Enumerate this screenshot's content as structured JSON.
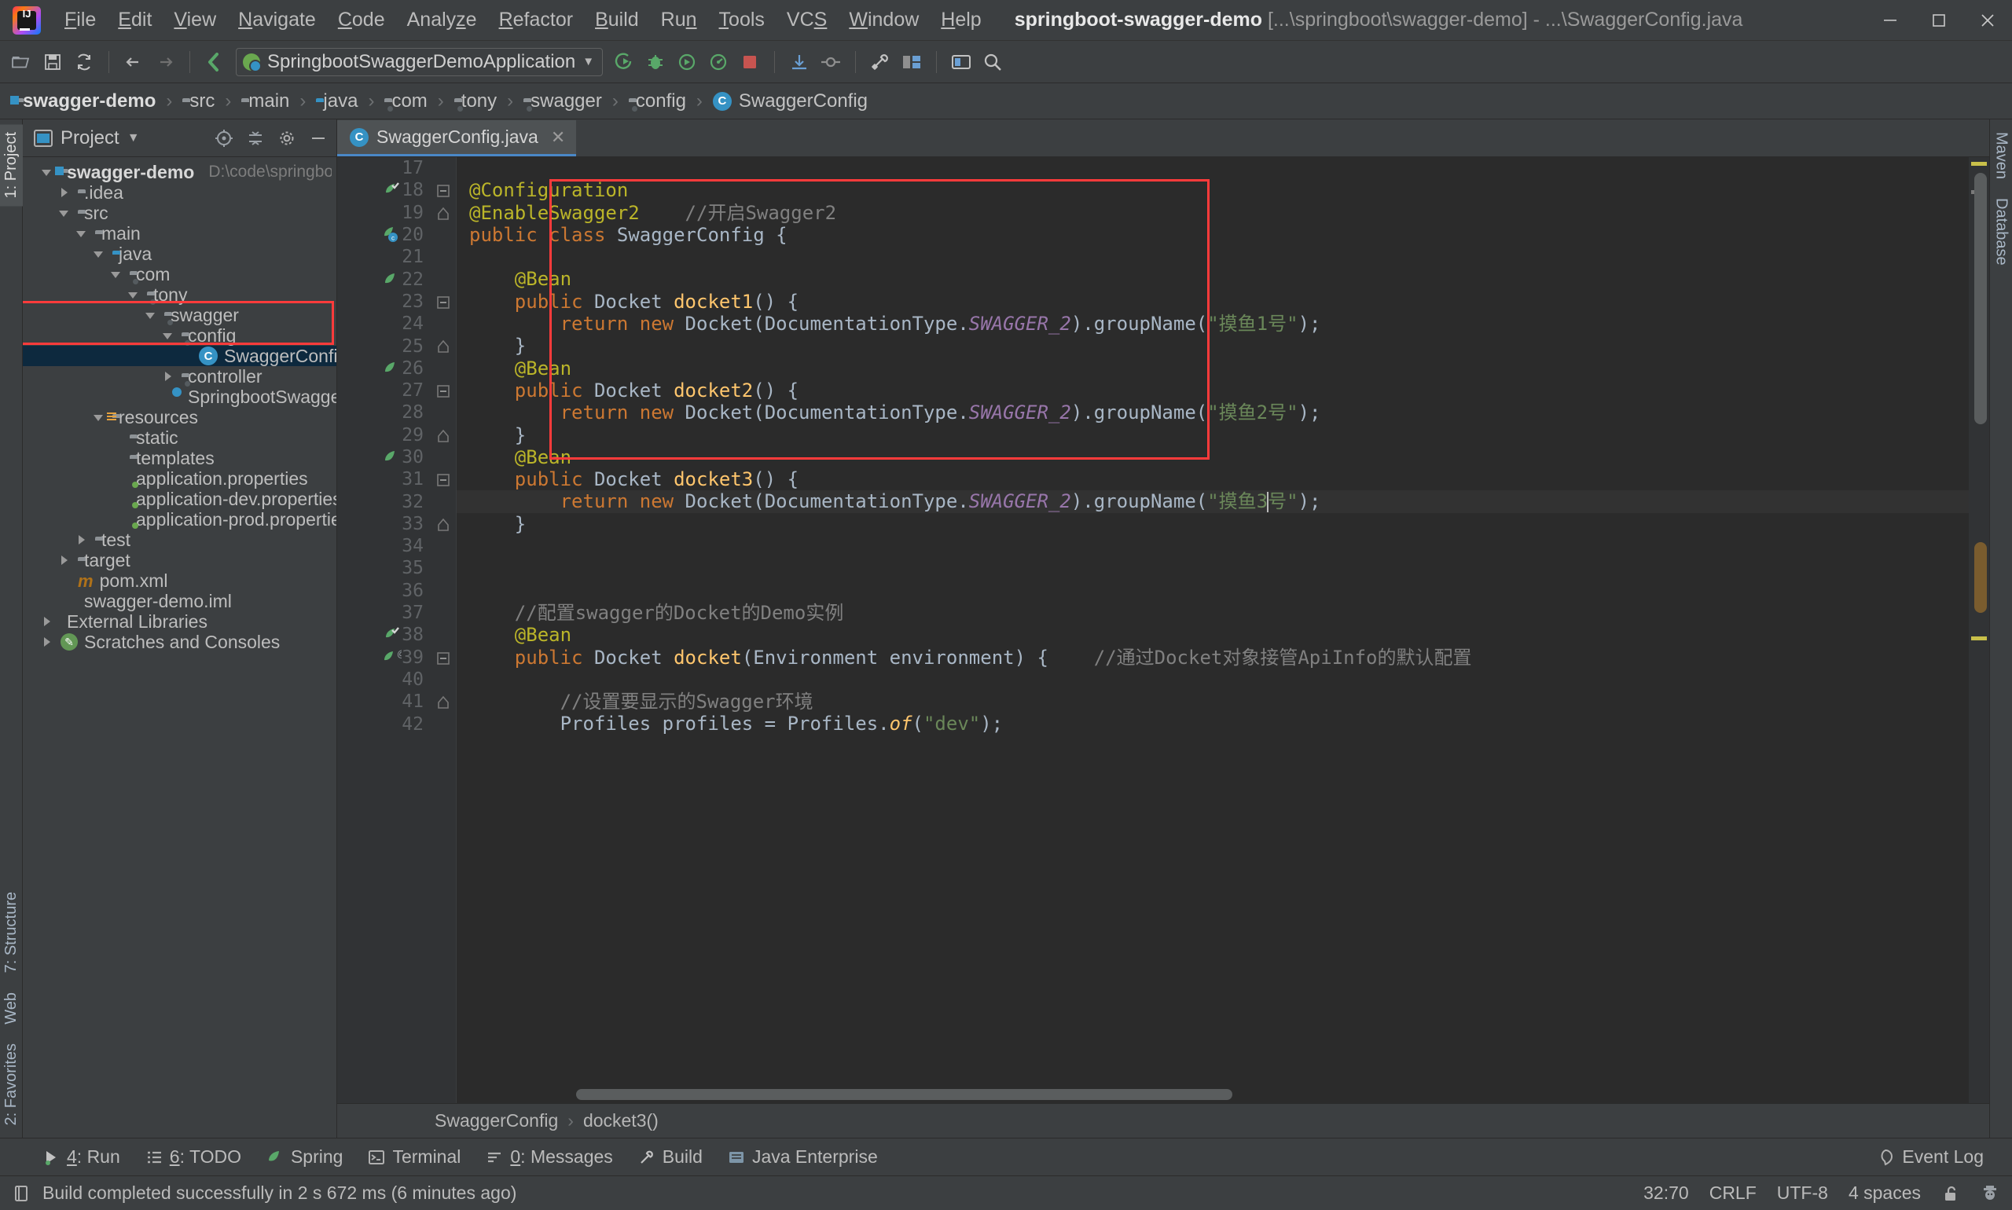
{
  "window": {
    "title_project": "springboot-swagger-demo",
    "title_path": "[...\\springboot\\swagger-demo] - ...\\SwaggerConfig.java",
    "minimize": "—",
    "maximize": "❐",
    "close": "✕"
  },
  "menu": [
    {
      "label": "File",
      "mnemonic": "F"
    },
    {
      "label": "Edit",
      "mnemonic": "E"
    },
    {
      "label": "View",
      "mnemonic": "V"
    },
    {
      "label": "Navigate",
      "mnemonic": "N"
    },
    {
      "label": "Code",
      "mnemonic": "C"
    },
    {
      "label": "Analyze",
      "mnemonic": "z"
    },
    {
      "label": "Refactor",
      "mnemonic": "R"
    },
    {
      "label": "Build",
      "mnemonic": "B"
    },
    {
      "label": "Run",
      "mnemonic": "n"
    },
    {
      "label": "Tools",
      "mnemonic": "T"
    },
    {
      "label": "VCS",
      "mnemonic": "S"
    },
    {
      "label": "Window",
      "mnemonic": "W"
    },
    {
      "label": "Help",
      "mnemonic": "H"
    }
  ],
  "toolbar": {
    "run_config": "SpringbootSwaggerDemoApplication",
    "icons": [
      "open-folder-icon",
      "save-all-icon",
      "sync-icon",
      "back-icon",
      "forward-icon",
      "compile-icon",
      "run-icon",
      "debug-icon",
      "run-coverage-icon",
      "profile-icon",
      "stop-icon",
      "update-project-icon",
      "commit-icon",
      "settings-icon",
      "project-structure-icon",
      "select-in-icon",
      "search-everywhere-icon"
    ]
  },
  "breadcrumb": [
    {
      "label": "swagger-demo",
      "icon": "module-folder-icon"
    },
    {
      "label": "src",
      "icon": "folder-icon"
    },
    {
      "label": "main",
      "icon": "folder-icon"
    },
    {
      "label": "java",
      "icon": "source-root-folder-icon"
    },
    {
      "label": "com",
      "icon": "package-icon"
    },
    {
      "label": "tony",
      "icon": "package-icon"
    },
    {
      "label": "swagger",
      "icon": "package-icon"
    },
    {
      "label": "config",
      "icon": "package-icon"
    },
    {
      "label": "SwaggerConfig",
      "icon": "java-class-icon"
    }
  ],
  "project_panel": {
    "title": "Project",
    "header_icons": [
      "target-icon",
      "collapse-all-icon",
      "gear-icon",
      "hide-icon"
    ],
    "tree": [
      {
        "label": "swagger-demo",
        "path": "D:\\code\\springboot\\swagger-de",
        "depth": 0,
        "arrow": "down",
        "icon": "module-folder-icon",
        "bold": true
      },
      {
        "label": ".idea",
        "path": "",
        "depth": 1,
        "arrow": "right",
        "icon": "folder-icon"
      },
      {
        "label": "src",
        "path": "",
        "depth": 1,
        "arrow": "down",
        "icon": "folder-icon"
      },
      {
        "label": "main",
        "path": "",
        "depth": 2,
        "arrow": "down",
        "icon": "folder-icon"
      },
      {
        "label": "java",
        "path": "",
        "depth": 3,
        "arrow": "down",
        "icon": "source-root-folder-icon"
      },
      {
        "label": "com",
        "path": "",
        "depth": 4,
        "arrow": "down",
        "icon": "package-icon"
      },
      {
        "label": "tony",
        "path": "",
        "depth": 5,
        "arrow": "down",
        "icon": "package-icon"
      },
      {
        "label": "swagger",
        "path": "",
        "depth": 6,
        "arrow": "down",
        "icon": "package-icon"
      },
      {
        "label": "config",
        "path": "",
        "depth": 7,
        "arrow": "down",
        "icon": "package-icon"
      },
      {
        "label": "SwaggerConfig",
        "path": "",
        "depth": 8,
        "arrow": "none",
        "icon": "java-class-icon",
        "selected": true
      },
      {
        "label": "controller",
        "path": "",
        "depth": 7,
        "arrow": "right",
        "icon": "package-icon"
      },
      {
        "label": "SpringbootSwaggerDemoA",
        "path": "",
        "depth": 7,
        "arrow": "none",
        "icon": "spring-boot-class-icon"
      },
      {
        "label": "resources",
        "path": "",
        "depth": 3,
        "arrow": "down",
        "icon": "resources-folder-icon"
      },
      {
        "label": "static",
        "path": "",
        "depth": 4,
        "arrow": "none",
        "icon": "folder-icon"
      },
      {
        "label": "templates",
        "path": "",
        "depth": 4,
        "arrow": "none",
        "icon": "folder-icon"
      },
      {
        "label": "application.properties",
        "path": "",
        "depth": 4,
        "arrow": "none",
        "icon": "properties-file-icon"
      },
      {
        "label": "application-dev.properties",
        "path": "",
        "depth": 4,
        "arrow": "none",
        "icon": "properties-file-icon"
      },
      {
        "label": "application-prod.properties",
        "path": "",
        "depth": 4,
        "arrow": "none",
        "icon": "properties-file-icon"
      },
      {
        "label": "test",
        "path": "",
        "depth": 2,
        "arrow": "right",
        "icon": "folder-icon"
      },
      {
        "label": "target",
        "path": "",
        "depth": 1,
        "arrow": "right",
        "icon": "excluded-folder-icon"
      },
      {
        "label": "pom.xml",
        "path": "",
        "depth": 1,
        "arrow": "none",
        "icon": "maven-xml-icon"
      },
      {
        "label": "swagger-demo.iml",
        "path": "",
        "depth": 1,
        "arrow": "none",
        "icon": "iml-file-icon"
      },
      {
        "label": "External Libraries",
        "path": "",
        "depth": 0,
        "arrow": "right",
        "icon": "libraries-icon"
      },
      {
        "label": "Scratches and Consoles",
        "path": "",
        "depth": 0,
        "arrow": "right",
        "icon": "scratches-icon"
      }
    ]
  },
  "rail_left": [
    {
      "label": "1: Project",
      "selected": true
    },
    {
      "label": "7: Structure",
      "selected": false
    },
    {
      "label": "Web",
      "selected": false
    },
    {
      "label": "2: Favorites",
      "selected": false
    }
  ],
  "rail_right": [
    {
      "label": "Maven",
      "selected": false
    },
    {
      "label": "Database",
      "selected": false
    }
  ],
  "editor": {
    "tab": {
      "label": "SwaggerConfig.java",
      "icon": "java-class-icon",
      "close": "✕"
    },
    "first_line_number": 17,
    "lines": [
      {
        "n": 17,
        "tokens": [],
        "gutter_icon": null,
        "fold": null
      },
      {
        "n": 18,
        "tokens": [
          {
            "t": "@Configuration",
            "c": "ann"
          }
        ],
        "gutter_icon": "spring-bean-check-icon",
        "fold": "start"
      },
      {
        "n": 19,
        "tokens": [
          {
            "t": "@EnableSwagger2",
            "c": "ann"
          },
          {
            "t": "    ",
            "c": "punc"
          },
          {
            "t": "//开启Swagger2",
            "c": "cmt"
          }
        ],
        "gutter_icon": null,
        "fold": "end"
      },
      {
        "n": 20,
        "tokens": [
          {
            "t": "public ",
            "c": "kw"
          },
          {
            "t": "class ",
            "c": "kw"
          },
          {
            "t": "SwaggerConfig ",
            "c": "cls-n"
          },
          {
            "t": "{",
            "c": "punc"
          }
        ],
        "gutter_icon": "spring-config-class-icon",
        "fold": null
      },
      {
        "n": 21,
        "tokens": [],
        "gutter_icon": null,
        "fold": null
      },
      {
        "n": 22,
        "tokens": [
          {
            "t": "    @Bean",
            "c": "ann"
          }
        ],
        "gutter_icon": "spring-bean-icon",
        "fold": null
      },
      {
        "n": 23,
        "tokens": [
          {
            "t": "    ",
            "c": "punc"
          },
          {
            "t": "public ",
            "c": "kw"
          },
          {
            "t": "Docket ",
            "c": "typ"
          },
          {
            "t": "docket1",
            "c": "mth"
          },
          {
            "t": "() {",
            "c": "punc"
          }
        ],
        "gutter_icon": null,
        "fold": "start"
      },
      {
        "n": 24,
        "tokens": [
          {
            "t": "        ",
            "c": "punc"
          },
          {
            "t": "return ",
            "c": "kw"
          },
          {
            "t": "new ",
            "c": "kw"
          },
          {
            "t": "Docket(DocumentationType.",
            "c": "typ"
          },
          {
            "t": "SWAGGER_2",
            "c": "fld"
          },
          {
            "t": ").groupName(",
            "c": "typ"
          },
          {
            "t": "\"摸鱼1号\"",
            "c": "str"
          },
          {
            "t": ");",
            "c": "punc"
          }
        ],
        "gutter_icon": null,
        "fold": null
      },
      {
        "n": 25,
        "tokens": [
          {
            "t": "    }",
            "c": "punc"
          }
        ],
        "gutter_icon": null,
        "fold": "end"
      },
      {
        "n": 26,
        "tokens": [
          {
            "t": "    @Bean",
            "c": "ann"
          }
        ],
        "gutter_icon": "spring-bean-icon",
        "fold": null
      },
      {
        "n": 27,
        "tokens": [
          {
            "t": "    ",
            "c": "punc"
          },
          {
            "t": "public ",
            "c": "kw"
          },
          {
            "t": "Docket ",
            "c": "typ"
          },
          {
            "t": "docket2",
            "c": "mth"
          },
          {
            "t": "() {",
            "c": "punc"
          }
        ],
        "gutter_icon": null,
        "fold": "start"
      },
      {
        "n": 28,
        "tokens": [
          {
            "t": "        ",
            "c": "punc"
          },
          {
            "t": "return ",
            "c": "kw"
          },
          {
            "t": "new ",
            "c": "kw"
          },
          {
            "t": "Docket(DocumentationType.",
            "c": "typ"
          },
          {
            "t": "SWAGGER_2",
            "c": "fld"
          },
          {
            "t": ").groupName(",
            "c": "typ"
          },
          {
            "t": "\"摸鱼2号\"",
            "c": "str"
          },
          {
            "t": ");",
            "c": "punc"
          }
        ],
        "gutter_icon": null,
        "fold": null
      },
      {
        "n": 29,
        "tokens": [
          {
            "t": "    }",
            "c": "punc"
          }
        ],
        "gutter_icon": null,
        "fold": "end"
      },
      {
        "n": 30,
        "tokens": [
          {
            "t": "    @Bean",
            "c": "ann"
          }
        ],
        "gutter_icon": "spring-bean-icon",
        "fold": null
      },
      {
        "n": 31,
        "tokens": [
          {
            "t": "    ",
            "c": "punc"
          },
          {
            "t": "public ",
            "c": "kw"
          },
          {
            "t": "Docket ",
            "c": "typ"
          },
          {
            "t": "docket3",
            "c": "mth"
          },
          {
            "t": "() {",
            "c": "punc"
          }
        ],
        "gutter_icon": null,
        "fold": "start"
      },
      {
        "n": 32,
        "tokens": [
          {
            "t": "        ",
            "c": "punc"
          },
          {
            "t": "return ",
            "c": "kw"
          },
          {
            "t": "new ",
            "c": "kw"
          },
          {
            "t": "Docket(DocumentationType.",
            "c": "typ"
          },
          {
            "t": "SWAGGER_2",
            "c": "fld"
          },
          {
            "t": ").groupName(",
            "c": "typ"
          },
          {
            "t": "\"摸鱼3",
            "c": "str"
          },
          {
            "t": "CARET",
            "c": "caret"
          },
          {
            "t": "号\"",
            "c": "str"
          },
          {
            "t": ");",
            "c": "punc"
          }
        ],
        "gutter_icon": null,
        "fold": null,
        "highlight": true
      },
      {
        "n": 33,
        "tokens": [
          {
            "t": "    }",
            "c": "punc"
          }
        ],
        "gutter_icon": null,
        "fold": "end"
      },
      {
        "n": 34,
        "tokens": [],
        "gutter_icon": null,
        "fold": null
      },
      {
        "n": 35,
        "tokens": [],
        "gutter_icon": null,
        "fold": null
      },
      {
        "n": 36,
        "tokens": [],
        "gutter_icon": null,
        "fold": null
      },
      {
        "n": 37,
        "tokens": [
          {
            "t": "    //配置swagger的Docket的Demo实例",
            "c": "cmt"
          }
        ],
        "gutter_icon": null,
        "fold": null
      },
      {
        "n": 38,
        "tokens": [
          {
            "t": "    @Bean",
            "c": "ann"
          }
        ],
        "gutter_icon": "spring-bean-check-icon",
        "fold": null
      },
      {
        "n": 39,
        "tokens": [
          {
            "t": "    ",
            "c": "punc"
          },
          {
            "t": "public ",
            "c": "kw"
          },
          {
            "t": "Docket ",
            "c": "typ"
          },
          {
            "t": "docket",
            "c": "mth"
          },
          {
            "t": "(Environment environment) {",
            "c": "typ"
          },
          {
            "t": "    ",
            "c": "punc"
          },
          {
            "t": "//通过Docket对象接管ApiInfo的默认配置",
            "c": "cmt"
          }
        ],
        "gutter_icon": "spring-bean-autowire-icon",
        "fold": "start"
      },
      {
        "n": 40,
        "tokens": [],
        "gutter_icon": null,
        "fold": null
      },
      {
        "n": 41,
        "tokens": [
          {
            "t": "        //设置要显示的Swagger环境",
            "c": "cmt"
          }
        ],
        "gutter_icon": null,
        "fold": "end"
      },
      {
        "n": 42,
        "tokens": [
          {
            "t": "        Profiles profiles = Profiles.",
            "c": "typ"
          },
          {
            "t": "of",
            "c": "mthi"
          },
          {
            "t": "(",
            "c": "punc"
          },
          {
            "t": "\"dev\"",
            "c": "str"
          },
          {
            "t": ");",
            "c": "punc"
          }
        ],
        "gutter_icon": null,
        "fold": null
      }
    ],
    "breadcrumb": [
      {
        "label": "SwaggerConfig"
      },
      {
        "label": "docket3()"
      }
    ]
  },
  "tool_windows": [
    {
      "label": "4: Run",
      "mnemonic": "4",
      "icon": "run-icon"
    },
    {
      "label": "6: TODO",
      "mnemonic": "6",
      "icon": "todo-icon"
    },
    {
      "label": "Spring",
      "mnemonic": "",
      "icon": "spring-leaf-icon"
    },
    {
      "label": "Terminal",
      "mnemonic": "",
      "icon": "terminal-icon"
    },
    {
      "label": "0: Messages",
      "mnemonic": "0",
      "icon": "messages-icon"
    },
    {
      "label": "Build",
      "mnemonic": "",
      "icon": "build-hammer-icon"
    },
    {
      "label": "Java Enterprise",
      "mnemonic": "",
      "icon": "java-enterprise-icon"
    }
  ],
  "event_log": {
    "label": "Event Log",
    "icon": "balloon-icon"
  },
  "statusbar": {
    "message": "Build completed successfully in 2 s 672 ms (6 minutes ago)",
    "caret_position": "32:70",
    "line_separator": "CRLF",
    "encoding": "UTF-8",
    "indent": "4 spaces",
    "lock_icon": "unlocked-icon",
    "inspector_icon": "hector-icon"
  },
  "colors": {
    "bg": "#3c3f41",
    "editor_bg": "#2b2b2b",
    "gutter_bg": "#313335",
    "selection": "#0d293e",
    "accent": "#4a88c7",
    "annotation_red": "#ff3b3b",
    "keyword": "#cc7832",
    "annotation": "#bbb529",
    "string": "#6a8759",
    "comment": "#808080",
    "method": "#ffc66d",
    "field": "#9876aa"
  }
}
